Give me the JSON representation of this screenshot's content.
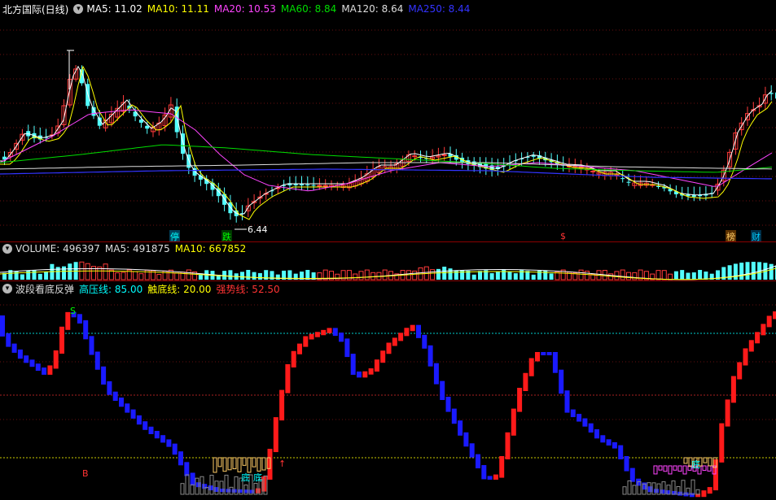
{
  "price_panel": {
    "title": "北方国际(日线)",
    "ma": [
      {
        "label": "MA5: 11.02",
        "color": "#ffffff"
      },
      {
        "label": "MA10: 11.11",
        "color": "#ffff00"
      },
      {
        "label": "MA20: 10.53",
        "color": "#ff44ff"
      },
      {
        "label": "MA60: 8.84",
        "color": "#00dd00"
      },
      {
        "label": "MA120: 8.64",
        "color": "#dddddd"
      },
      {
        "label": "MA250: 8.44",
        "color": "#3333ff"
      }
    ],
    "low_label": "6.44",
    "markers": [
      {
        "text": "停",
        "color": "#00ffff",
        "bg": "#00405a"
      },
      {
        "text": "跌",
        "color": "#00ff00",
        "bg": "#003a00"
      },
      {
        "text": "$",
        "color": "#ff3333",
        "bg": ""
      },
      {
        "text": "榜",
        "color": "#ffcc66",
        "bg": "#5a3000"
      },
      {
        "text": "财",
        "color": "#00ccff",
        "bg": "#00304a"
      }
    ]
  },
  "volume_panel": {
    "items": [
      {
        "label": "VOLUME: 496397",
        "color": "#dddddd"
      },
      {
        "label": "MA5: 491875",
        "color": "#dddddd"
      },
      {
        "label": "MA10: 667852",
        "color": "#ffff00"
      }
    ]
  },
  "indicator_panel": {
    "title": "波段看底反弹",
    "items": [
      {
        "label": "高压线: 85.00",
        "color": "#00ffff"
      },
      {
        "label": "触底线: 20.00",
        "color": "#ffff00"
      },
      {
        "label": "强势线: 52.50",
        "color": "#ff3333"
      }
    ],
    "signals": [
      {
        "text": "S",
        "color": "#00ff00"
      },
      {
        "text": "B",
        "color": "#ff3333"
      },
      {
        "text": "底",
        "color": "#00ffff"
      },
      {
        "text": "底",
        "color": "#00ffff"
      },
      {
        "text": "↑",
        "color": "#ff3333"
      },
      {
        "text": "底",
        "color": "#00ffff"
      }
    ]
  }
}
